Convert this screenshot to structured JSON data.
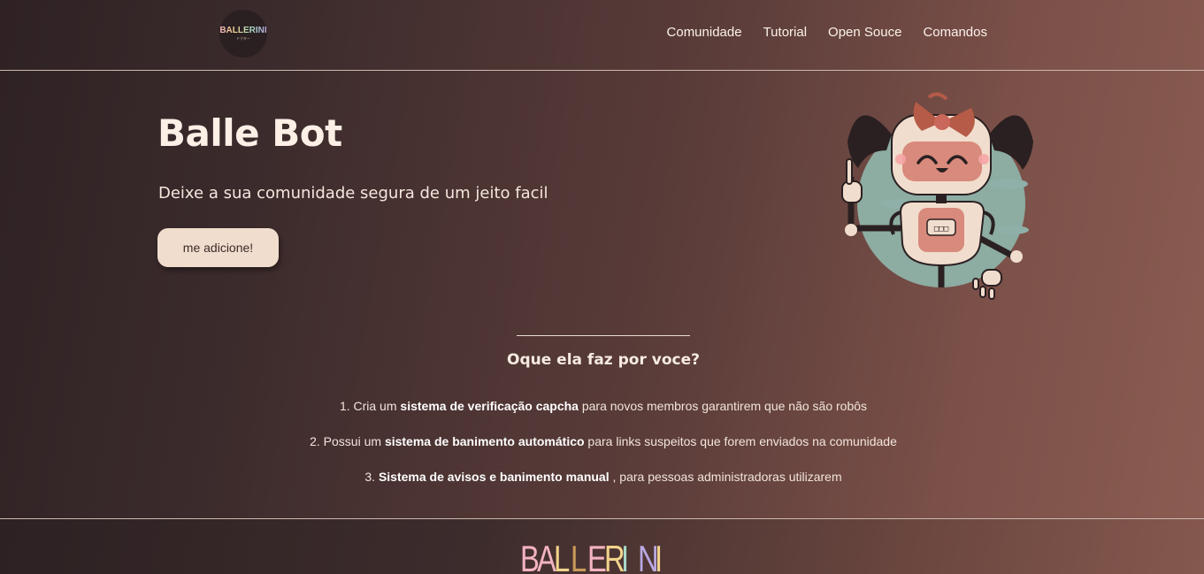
{
  "header": {
    "logo_text": "BALLERINI",
    "logo_sub": "ドクター",
    "nav": [
      "Comunidade",
      "Tutorial",
      "Open Souce",
      "Comandos"
    ]
  },
  "hero": {
    "title": "Balle Bot",
    "subtitle": "Deixe a sua comunidade segura de um jeito facil",
    "cta_label": "me adicione!",
    "robot_screen_label": "□□□"
  },
  "section": {
    "title": "Oque ela faz por voce?",
    "features": [
      {
        "prefix": "1. Cria um ",
        "bold": "sistema de verificação capcha",
        "suffix": " para novos membros garantirem que não são robôs"
      },
      {
        "prefix": "2. Possui um ",
        "bold": "sistema de banimento automático",
        "suffix": " para links suspeitos que forem enviados na comunidade"
      },
      {
        "prefix": "3. ",
        "bold": "Sistema de avisos e banimento manual",
        "suffix": " , para pessoas administradoras utilizarem"
      }
    ]
  },
  "footer": {
    "brand_letters": [
      "B",
      "A",
      "L",
      "L",
      "E",
      "R",
      "I",
      "N",
      "I"
    ],
    "brand_colors": [
      "#f3b3c0",
      "#f3b3c0",
      "#f2d48c",
      "#c99a5a",
      "#f3b3c0",
      "#f2d48c",
      "#a9d9c8",
      "#b9a8e2",
      "#f2d48c"
    ]
  },
  "colors": {
    "bg_dark": "#2f2224",
    "bg_light": "#8b5c52",
    "button_bg": "#f1ddcd",
    "robot_body": "#f1ddcd",
    "robot_accent": "#d88a7c"
  }
}
